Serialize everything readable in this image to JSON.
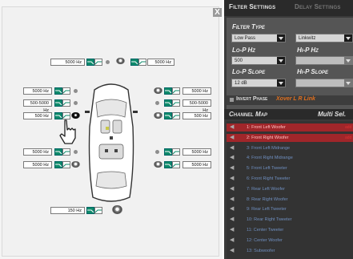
{
  "close_label": "X",
  "tabs": {
    "filter_settings": "Filter Settings",
    "delay_settings": "Delay Settings"
  },
  "filter": {
    "filter_type_label": "Filter Type",
    "filter_type_value": "Low Pass",
    "filter_shape_value": "Linkwitz",
    "lop_hz_label": "Lo-P Hz",
    "hip_hz_label": "Hi-P Hz",
    "lop_hz_value": "500",
    "hip_hz_value": "",
    "lop_slope_label": "Lo-P Slope",
    "hip_slope_label": "Hi-P Slope",
    "lop_slope_value": "12 dB",
    "hip_slope_value": "",
    "invert_phase_label": "Invert Phase",
    "xover_link_label": "Xover L R Link"
  },
  "channel_map": {
    "title": "Channel Map",
    "multi_select": "Multi Sel.",
    "rows": [
      {
        "label": "1: Front Left Woofer",
        "tag": "add",
        "selected": true
      },
      {
        "label": "2: Front Right Woofer",
        "tag": "add",
        "selected": true
      },
      {
        "label": "3: Front Left Midrange",
        "tag": "",
        "selected": false
      },
      {
        "label": "4: Front Right Midrange",
        "tag": "",
        "selected": false
      },
      {
        "label": "5: Front Left Tweeter",
        "tag": "",
        "selected": false
      },
      {
        "label": "6: Front Right Tweeter",
        "tag": "",
        "selected": false
      },
      {
        "label": "7: Rear Left Woofer",
        "tag": "",
        "selected": false
      },
      {
        "label": "8: Rear Right Woofer",
        "tag": "",
        "selected": false
      },
      {
        "label": "9: Rear Left Tweeter",
        "tag": "",
        "selected": false
      },
      {
        "label": "10: Rear Right Tweeter",
        "tag": "",
        "selected": false
      },
      {
        "label": "11: Center Tweeter",
        "tag": "",
        "selected": false
      },
      {
        "label": "12: Center Woofer",
        "tag": "",
        "selected": false
      },
      {
        "label": "13: Subwoofer",
        "tag": "",
        "selected": false
      }
    ]
  },
  "car": {
    "center_top_left": "5000 Hz",
    "center_top_right": "5000 Hz",
    "fl_tweeter": "5000 Hz",
    "fl_mid": "500-5000 Hz",
    "fl_woofer": "500 Hz",
    "fr_tweeter": "5000 Hz",
    "fr_mid": "500-5000 Hz",
    "fr_woofer": "500 Hz",
    "rl_tweeter": "5000 Hz",
    "rl_woofer": "5000 Hz",
    "rr_tweeter": "5000 Hz",
    "rr_woofer": "5000 Hz",
    "subwoofer": "150 Hz"
  },
  "colors": {
    "filter_green": "#0d8a6a",
    "selected_row": "#a0262a",
    "xover_orange": "#e07020",
    "panel_dark": "#3a3a3a"
  }
}
